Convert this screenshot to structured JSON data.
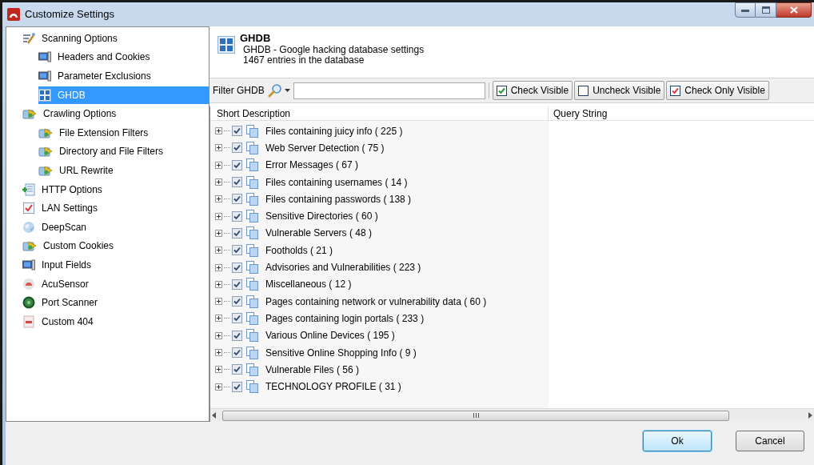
{
  "window": {
    "title": "Customize Settings"
  },
  "sidebar": {
    "items": [
      {
        "label": "Scanning Options",
        "selected": false,
        "children": [
          {
            "label": "Headers and Cookies",
            "selected": false
          },
          {
            "label": "Parameter Exclusions",
            "selected": false
          },
          {
            "label": "GHDB",
            "selected": true
          }
        ]
      },
      {
        "label": "Crawling Options",
        "selected": false,
        "children": [
          {
            "label": "File Extension Filters",
            "selected": false
          },
          {
            "label": "Directory and File Filters",
            "selected": false
          },
          {
            "label": "URL Rewrite",
            "selected": false
          }
        ]
      },
      {
        "label": "HTTP Options",
        "selected": false
      },
      {
        "label": "LAN Settings",
        "selected": false
      },
      {
        "label": "DeepScan",
        "selected": false
      },
      {
        "label": "Custom Cookies",
        "selected": false
      },
      {
        "label": "Input Fields",
        "selected": false
      },
      {
        "label": "AcuSensor",
        "selected": false
      },
      {
        "label": "Port Scanner",
        "selected": false
      },
      {
        "label": "Custom 404",
        "selected": false
      }
    ]
  },
  "header": {
    "title": "GHDB",
    "description": "GHDB - Google hacking database settings",
    "count": "1467 entries in the database"
  },
  "filter": {
    "label": "Filter GHDB"
  },
  "toolbar_buttons": [
    {
      "label": "Check Visible"
    },
    {
      "label": "Uncheck Visible"
    },
    {
      "label": "Check Only Visible"
    }
  ],
  "table": {
    "columns": [
      "Short Description",
      "Query String"
    ],
    "rows": [
      {
        "label": "Files containing juicy info ( 225 )",
        "checked": true
      },
      {
        "label": "Web Server Detection ( 75 )",
        "checked": true
      },
      {
        "label": "Error Messages ( 67 )",
        "checked": true
      },
      {
        "label": "Files containing usernames ( 14 )",
        "checked": true
      },
      {
        "label": "Files containing passwords ( 138 )",
        "checked": true
      },
      {
        "label": "Sensitive Directories ( 60 )",
        "checked": true
      },
      {
        "label": "Vulnerable Servers ( 48 )",
        "checked": true
      },
      {
        "label": "Footholds ( 21 )",
        "checked": true
      },
      {
        "label": "Advisories and Vulnerabilities ( 223 )",
        "checked": true
      },
      {
        "label": "Miscellaneous ( 12 )",
        "checked": true
      },
      {
        "label": "Pages containing network or vulnerability data ( 60 )",
        "checked": true
      },
      {
        "label": "Pages containing login portals ( 233 )",
        "checked": true
      },
      {
        "label": "Various Online Devices ( 195 )",
        "checked": true
      },
      {
        "label": "Sensitive Online Shopping Info ( 9 )",
        "checked": true
      },
      {
        "label": "Vulnerable Files ( 56 )",
        "checked": true
      },
      {
        "label": "TECHNOLOGY PROFILE ( 31 )",
        "checked": true
      }
    ]
  },
  "buttons": [
    {
      "label": "Ok",
      "kind": "default"
    },
    {
      "label": "Cancel",
      "kind": "normal"
    }
  ]
}
